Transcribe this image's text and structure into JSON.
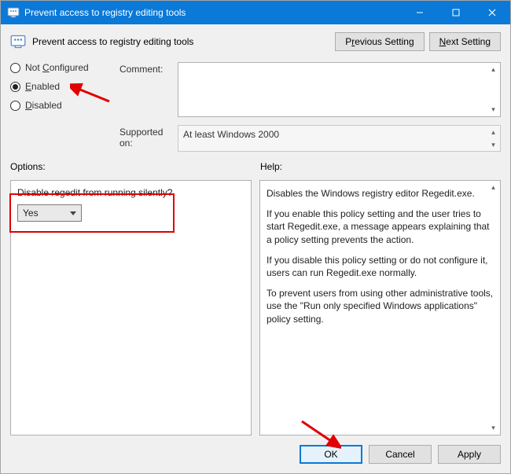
{
  "window": {
    "title": "Prevent access to registry editing tools"
  },
  "header": {
    "title": "Prevent access to registry editing tools",
    "prev_label_pre": "P",
    "prev_label_ul": "r",
    "prev_label_post": "evious Setting",
    "next_label_ul": "N",
    "next_label_post": "ext Setting"
  },
  "radios": {
    "not_configured_pre": "Not ",
    "not_configured_ul": "C",
    "not_configured_post": "onfigured",
    "enabled_ul": "E",
    "enabled_post": "nabled",
    "disabled_ul": "D",
    "disabled_post": "isabled",
    "selected": "enabled"
  },
  "fields": {
    "comment_label": "Comment:",
    "comment_value": "",
    "supported_label": "Supported on:",
    "supported_value": "At least Windows 2000"
  },
  "sections": {
    "options_label": "Options:",
    "help_label": "Help:"
  },
  "options": {
    "question": "Disable regedit from running silently?",
    "value": "Yes"
  },
  "help": {
    "p1": "Disables the Windows registry editor Regedit.exe.",
    "p2": "If you enable this policy setting and the user tries to start Regedit.exe, a message appears explaining that a policy setting prevents the action.",
    "p3": "If you disable this policy setting or do not configure it, users can run Regedit.exe normally.",
    "p4": "To prevent users from using other administrative tools, use the \"Run only specified Windows applications\" policy setting."
  },
  "buttons": {
    "ok": "OK",
    "cancel": "Cancel",
    "apply": "Apply"
  }
}
